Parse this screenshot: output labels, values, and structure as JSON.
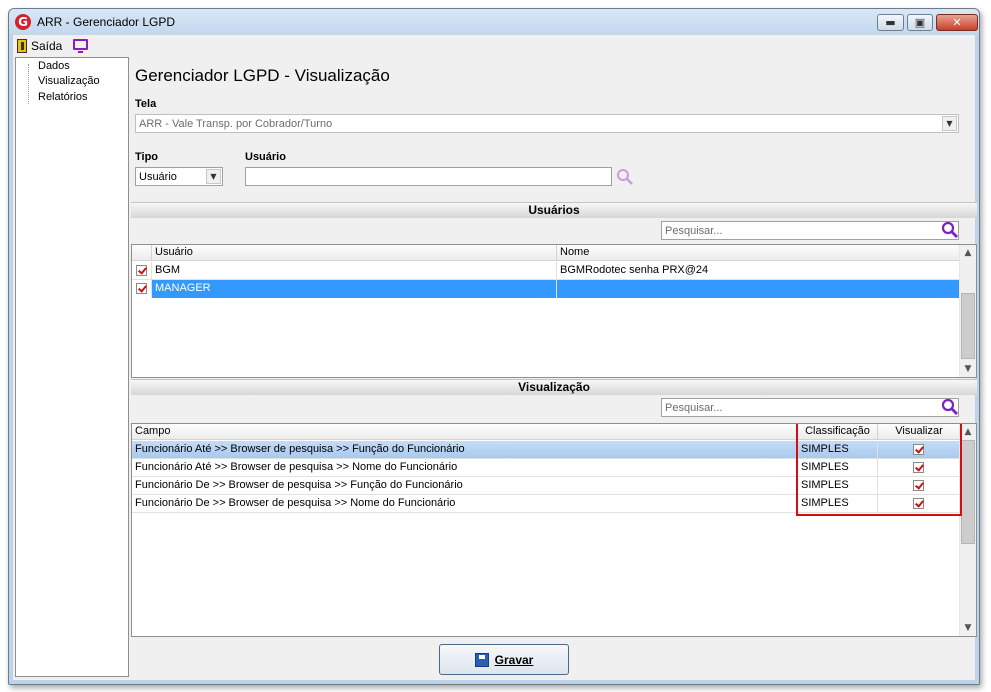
{
  "window": {
    "title": "ARR - Gerenciador LGPD",
    "logo_letter": "G",
    "minimize_glyph": "▬",
    "maximize_glyph": "▣",
    "close_glyph": "✕"
  },
  "toolbar": {
    "exit_label": "Saída",
    "exit_icon": "door-exit-icon",
    "monitor_icon": "monitor-icon"
  },
  "sidebar": {
    "items": [
      {
        "label": "Dados"
      },
      {
        "label": "Visualização"
      },
      {
        "label": "Relatórios"
      }
    ]
  },
  "main": {
    "title": "Gerenciador LGPD - Visualização",
    "tela_label": "Tela",
    "tela_value": "ARR - Vale Transp. por Cobrador/Turno",
    "tipo_label": "Tipo",
    "tipo_value": "Usuário",
    "usuario_label": "Usuário",
    "usuario_value": ""
  },
  "users_section": {
    "title": "Usuários",
    "search_placeholder": "Pesquisar...",
    "columns": [
      "Usuário",
      "Nome"
    ],
    "rows": [
      {
        "checked": true,
        "usuario": "BGM",
        "nome": "BGMRodotec senha PRX@24",
        "selected": false
      },
      {
        "checked": true,
        "usuario": "MANAGER",
        "nome": "",
        "selected": true
      }
    ]
  },
  "view_section": {
    "title": "Visualização",
    "search_placeholder": "Pesquisar...",
    "columns": [
      "Campo",
      "Classificação",
      "Visualizar"
    ],
    "rows": [
      {
        "campo": "Funcionário Até >> Browser de pesquisa >> Função do Funcionário",
        "classificacao": "SIMPLES",
        "visualizar": true,
        "highlighted": true
      },
      {
        "campo": "Funcionário Até >> Browser de pesquisa >> Nome do Funcionário",
        "classificacao": "SIMPLES",
        "visualizar": true,
        "highlighted": false
      },
      {
        "campo": "Funcionário De >> Browser de pesquisa >> Função do Funcionário",
        "classificacao": "SIMPLES",
        "visualizar": true,
        "highlighted": false
      },
      {
        "campo": "Funcionário De >> Browser de pesquisa >> Nome do Funcionário",
        "classificacao": "SIMPLES",
        "visualizar": true,
        "highlighted": false
      }
    ]
  },
  "footer": {
    "save_label": "Gravar",
    "save_icon": "floppy-disk-icon"
  },
  "colors": {
    "selection": "#3399ff",
    "highlight_box": "#d10d15",
    "check_mark": "#cc1111",
    "search_icon": "#7a22c8"
  }
}
